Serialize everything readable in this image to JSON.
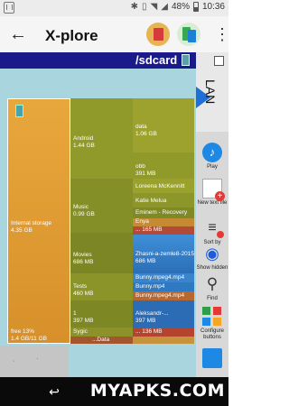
{
  "status_bar": {
    "battery": "48%",
    "time": "10:36",
    "icons": [
      "notification-icon",
      "bluetooth-icon",
      "vibrate-icon",
      "wifi-icon",
      "signal-icon",
      "battery-icon"
    ]
  },
  "app_bar": {
    "title": "X-plore",
    "back_icon": "arrow-left-icon",
    "overflow_icon": "more-vert-icon"
  },
  "path": {
    "label": "/sdcard"
  },
  "lan_tab": {
    "label": "LAN"
  },
  "side_buttons": [
    {
      "label": "Play",
      "icon": "play-icon"
    },
    {
      "label": "New text file",
      "icon": "new-file-icon"
    },
    {
      "label": "Sort by",
      "icon": "sort-icon"
    },
    {
      "label": "Show hidden",
      "icon": "eye-icon"
    },
    {
      "label": "Find",
      "icon": "search-icon"
    },
    {
      "label": "Configure buttons",
      "icon": "config-icon"
    },
    {
      "label": "",
      "icon": "copy-icon"
    }
  ],
  "treemap": {
    "root": {
      "name": "Internal storage",
      "size": "4.35 GB",
      "free_label": "free 13%",
      "free_size": "1.4 GB/11 GB"
    },
    "folders": [
      {
        "name": "Android",
        "size": "1.44 GB"
      },
      {
        "name": "Music",
        "size": "0.99 GB"
      },
      {
        "name": "Movies",
        "size": "686 MB"
      },
      {
        "name": "Tests",
        "size": "460 MB"
      },
      {
        "name": "1",
        "size": "397 MB"
      },
      {
        "name": "Sygic",
        "size": ""
      }
    ],
    "sub": [
      {
        "name": "data",
        "size": "1.06 GB"
      },
      {
        "name": "obb",
        "size": "391 MB"
      },
      {
        "name": "Loreena McKennitt",
        "size": ""
      },
      {
        "name": "Katie Melua",
        "size": ""
      },
      {
        "name": "Eminem - Recovery",
        "size": ""
      },
      {
        "name": "Enya",
        "size": ""
      },
      {
        "name": "...",
        "size": "165 MB"
      },
      {
        "name": "Zhasni-a-zemle8-2015...",
        "size": "686 MB"
      },
      {
        "name": "Bunny.mpeg4.mp4",
        "size": ""
      },
      {
        "name": "Bunny.mp4",
        "size": ""
      },
      {
        "name": "Bunny.mpeg4.mp4",
        "size": ""
      },
      {
        "name": "Aleksandr-...",
        "size": "397 MB"
      },
      {
        "name": "...",
        "size": "136 MB"
      },
      {
        "name": "...Data",
        "size": ""
      }
    ]
  },
  "nav": {
    "back_icon": "nav-back-icon",
    "watermark": "MYAPKS.COM"
  },
  "colors": {
    "path_bar": "#1a1a8a",
    "pane_bg": "#a9d6de",
    "root_orange": "#e9a33a",
    "folder_olive": "#8f9a2b",
    "accent_blue": "#1e88e5"
  }
}
